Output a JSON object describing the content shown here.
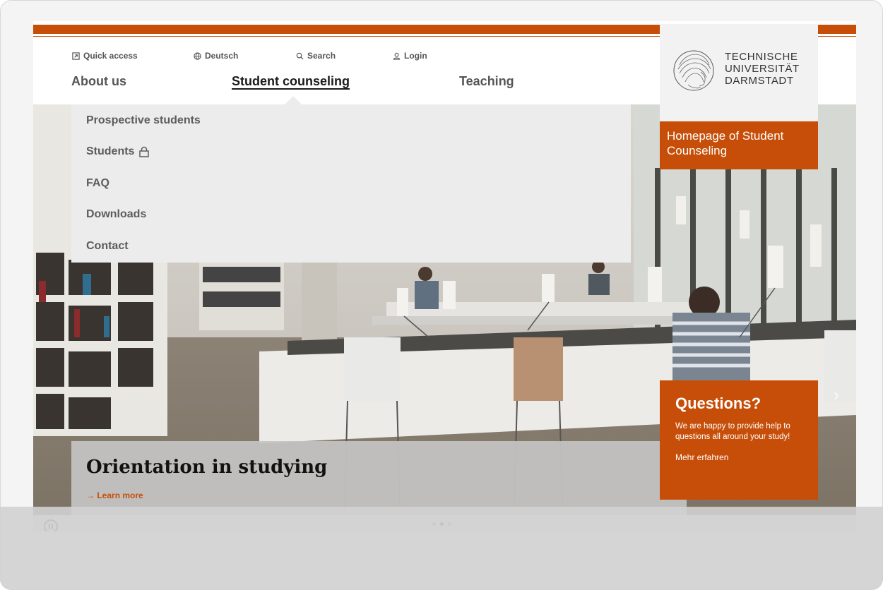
{
  "utility": {
    "quick_access": "Quick access",
    "language": "Deutsch",
    "search": "Search",
    "login": "Login"
  },
  "nav": {
    "items": [
      {
        "label": "About us"
      },
      {
        "label": "Student counseling",
        "active": true
      },
      {
        "label": "Teaching"
      }
    ]
  },
  "dropdown": {
    "items": [
      {
        "label": "Prospective students"
      },
      {
        "label": "Students",
        "icon": "lock-icon"
      },
      {
        "label": "FAQ"
      },
      {
        "label": "Downloads"
      },
      {
        "label": "Contact"
      }
    ]
  },
  "logo": {
    "line1": "TECHNISCHE",
    "line2": "UNIVERSITÄT",
    "line3": "DARMSTADT"
  },
  "homepage_link": "Homepage of Student Counseling",
  "questions": {
    "title": "Questions?",
    "body": "We are happy to provide help to questions all around your study!",
    "more": "Mehr erfahren"
  },
  "hero": {
    "title": "Orientation in studying",
    "link": "Learn more",
    "link_arrow": "→"
  },
  "slider": {
    "slide_count": 3,
    "active_index": 1
  },
  "colors": {
    "accent": "#c64e08",
    "dropdown_bg": "#ececec",
    "caption_bg": "#c4c4c4"
  }
}
